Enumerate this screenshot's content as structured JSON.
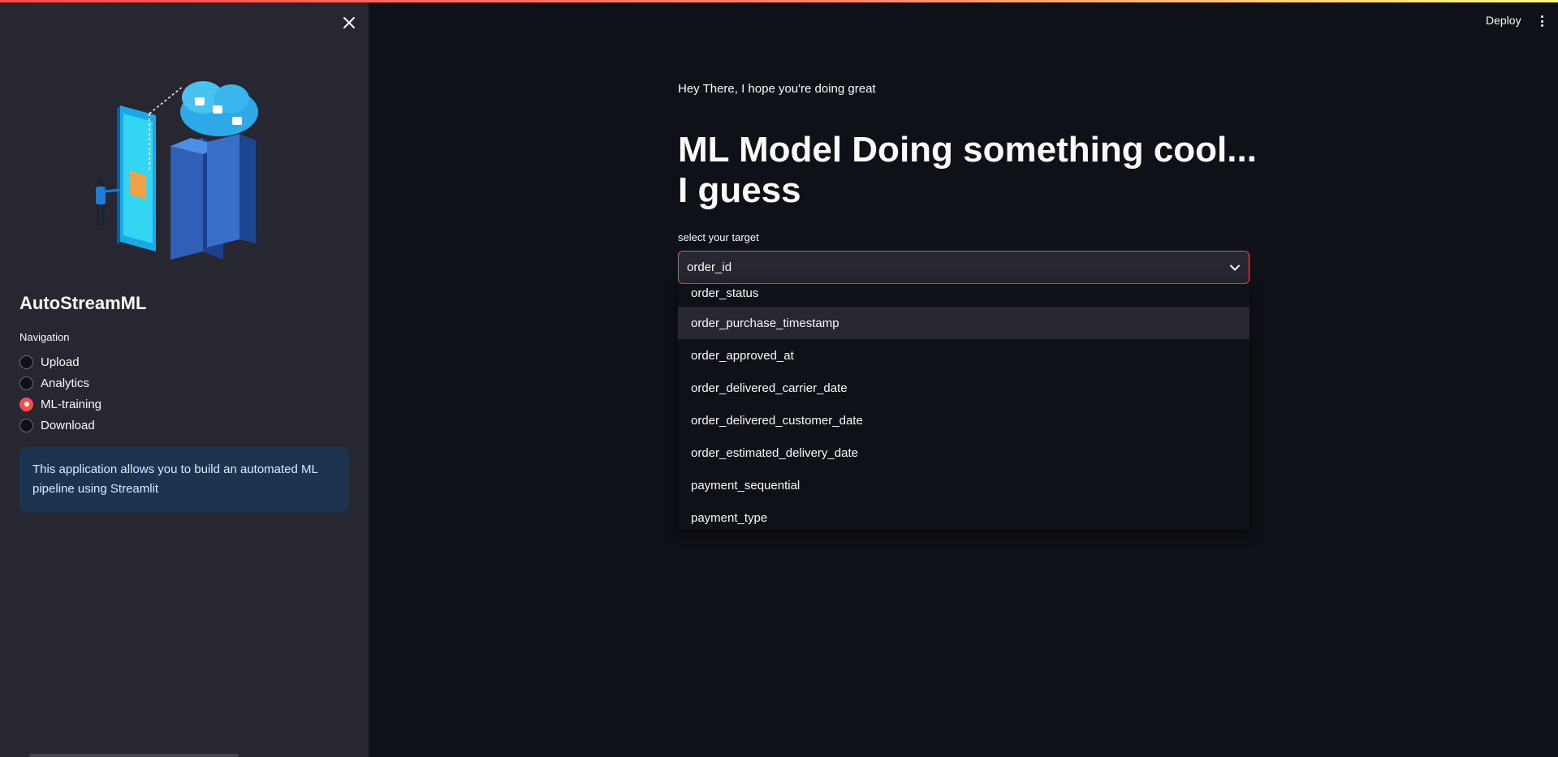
{
  "header": {
    "deploy_label": "Deploy"
  },
  "sidebar": {
    "app_title": "AutoStreamML",
    "nav_label": "Navigation",
    "nav_items": [
      {
        "label": "Upload",
        "selected": false
      },
      {
        "label": "Analytics",
        "selected": false
      },
      {
        "label": "ML-training",
        "selected": true
      },
      {
        "label": "Download",
        "selected": false
      }
    ],
    "info_text": "This application allows you to build an automated ML pipeline using Streamlit"
  },
  "main": {
    "greeting": "Hey There, I hope you're doing great",
    "title": "ML Model Doing something cool... I guess",
    "select_label": "select your target",
    "selected_value": "order_id",
    "options": [
      "order_status",
      "order_purchase_timestamp",
      "order_approved_at",
      "order_delivered_carrier_date",
      "order_delivered_customer_date",
      "order_estimated_delivery_date",
      "payment_sequential",
      "payment_type"
    ],
    "hovered_option_index": 1
  },
  "colors": {
    "accent": "#ff4b4b",
    "sidebar_bg": "#262730",
    "main_bg": "#0e1117",
    "info_bg": "#1c3450"
  }
}
